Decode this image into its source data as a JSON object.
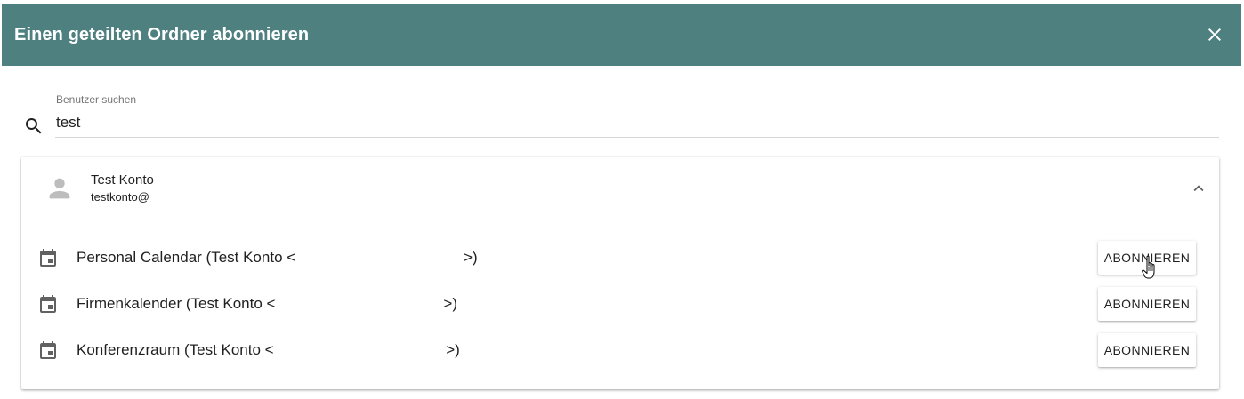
{
  "dialog": {
    "title": "Einen geteilten Ordner abonnieren",
    "header_color": "#4e8080",
    "close_icon": "close-icon"
  },
  "search": {
    "label": "Benutzer suchen",
    "value": "test",
    "icon": "search-icon"
  },
  "user": {
    "name": "Test Konto",
    "email": "testkonto@",
    "avatar_icon": "person-icon",
    "expand_icon": "chevron-up-icon"
  },
  "folders": [
    {
      "label": "Personal Calendar (Test Konto <                                        >)",
      "icon": "calendar-icon",
      "button_label": "ABONNIEREN"
    },
    {
      "label": "Firmenkalender (Test Konto <                                        >)",
      "icon": "calendar-icon",
      "button_label": "ABONNIEREN"
    },
    {
      "label": "Konferenzraum (Test Konto <                                         >)",
      "icon": "calendar-icon",
      "button_label": "ABONNIEREN"
    }
  ]
}
